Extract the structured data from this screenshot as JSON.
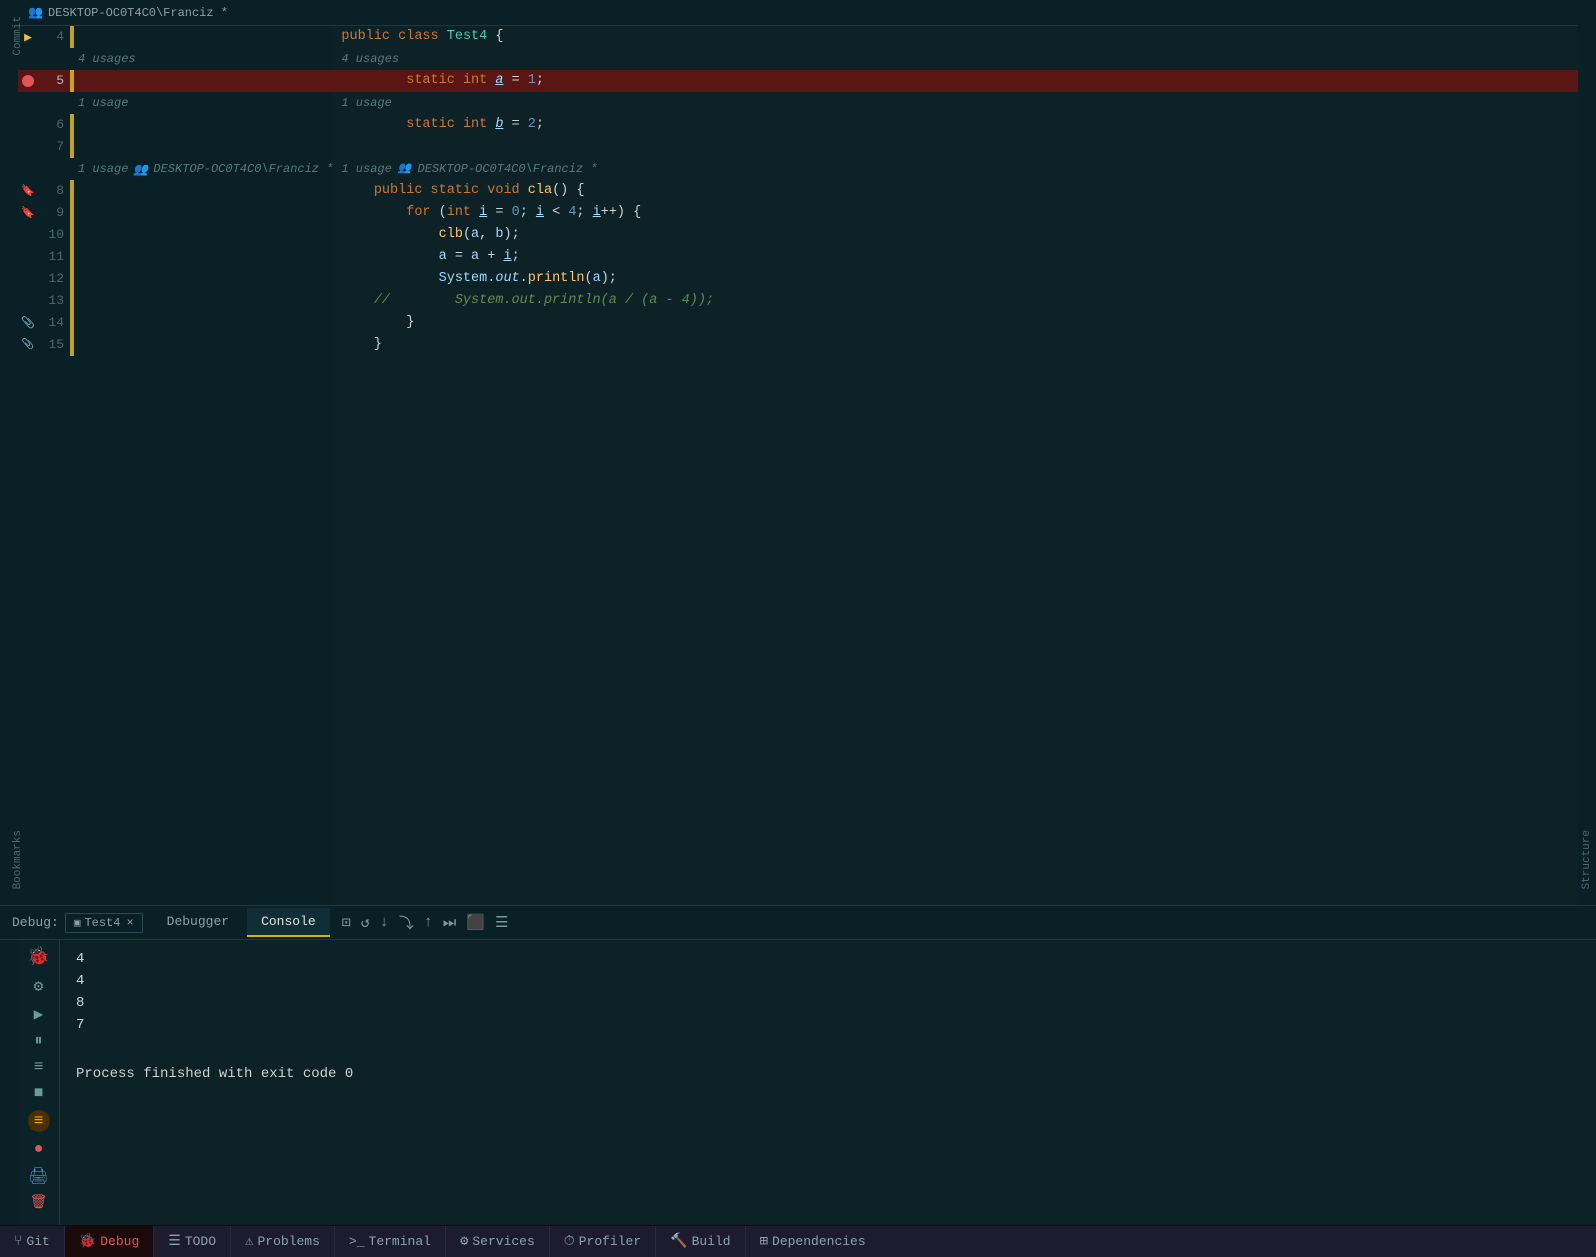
{
  "editor": {
    "git_info": "DESKTOP-OC0T4C0\\Franciz *",
    "lines": [
      {
        "num": 4,
        "content_html": "<span class='kw-public'>public</span> <span class='kw-class'>class</span> <span class='type-name'>Test4</span> <span class='punct'>{</span>",
        "meta": "4 usages",
        "has_arrow": true,
        "has_breakpoint": false,
        "has_bookmark": false,
        "highlighted": false
      },
      {
        "num": 5,
        "content_html": "    <span class='kw-static'>static</span> <span class='kw-int'>int</span> <span class='var-name italic underline'>a</span> = <span class='num'>1</span>;",
        "meta": "1 usage",
        "has_arrow": false,
        "has_breakpoint": true,
        "has_bookmark": false,
        "highlighted": true
      },
      {
        "num": 6,
        "content_html": "    <span class='kw-static'>static</span> <span class='kw-int'>int</span> <span class='var-name italic underline'>b</span> = <span class='num'>2</span>;",
        "meta": null,
        "has_arrow": false,
        "has_breakpoint": false,
        "has_bookmark": false,
        "highlighted": false
      },
      {
        "num": 7,
        "content_html": "",
        "meta": null,
        "has_arrow": false,
        "has_breakpoint": false,
        "has_bookmark": false,
        "highlighted": false
      },
      {
        "num": 8,
        "content_html": "    <span class='kw-public'>public</span> <span class='kw-static'>static</span> <span class='kw-void'>void</span> <span class='method-name'>cla</span>() {",
        "meta_with_user": "1 usage   DESKTOP-OC0T4C0\\Franciz *",
        "has_arrow": false,
        "has_breakpoint": false,
        "has_bookmark": true,
        "bookmark_color": "blue",
        "highlighted": false
      },
      {
        "num": 9,
        "content_html": "        <span class='kw-for'>for</span> (<span class='kw-int'>int</span> <span class='var-name underline'>i</span> = <span class='num'>0</span>; <span class='var-name underline'>i</span> &lt; <span class='num'>4</span>; <span class='var-name underline'>i</span>++) {",
        "meta": null,
        "has_arrow": false,
        "has_breakpoint": false,
        "has_bookmark": true,
        "bookmark_color": "yellow",
        "highlighted": false
      },
      {
        "num": 10,
        "content_html": "            <span class='method-name'>clb</span>(<span class='var-name'>a</span>, <span class='var-name'>b</span>);",
        "meta": null,
        "has_arrow": false,
        "has_breakpoint": false,
        "has_bookmark": false,
        "highlighted": false
      },
      {
        "num": 11,
        "content_html": "            <span class='var-name'>a</span> = <span class='var-name'>a</span> + <span class='var-name underline'>i</span>;",
        "meta": null,
        "has_arrow": false,
        "has_breakpoint": false,
        "has_bookmark": false,
        "highlighted": false
      },
      {
        "num": 12,
        "content_html": "            <span class='sys-out'>System</span>.<span class='kw-out'>out</span>.<span class='method-name'>println</span>(<span class='var-name'>a</span>);",
        "meta": null,
        "has_arrow": false,
        "has_breakpoint": false,
        "has_bookmark": false,
        "highlighted": false
      },
      {
        "num": 13,
        "content_html": "    <span class='comment'>// &nbsp;&nbsp;&nbsp;&nbsp;&nbsp;&nbsp;&nbsp;System.out.println(a / (a - 4));</span>",
        "meta": null,
        "has_arrow": false,
        "has_breakpoint": false,
        "has_bookmark": false,
        "highlighted": false
      },
      {
        "num": 14,
        "content_html": "        }",
        "meta": null,
        "has_arrow": false,
        "has_breakpoint": false,
        "has_bookmark": true,
        "bookmark_color": "green",
        "highlighted": false
      },
      {
        "num": 15,
        "content_html": "    }",
        "meta": null,
        "has_arrow": false,
        "has_breakpoint": false,
        "has_bookmark": true,
        "bookmark_color": "green2",
        "highlighted": false
      }
    ]
  },
  "debug": {
    "title": "Debug:",
    "tab_file": "Test4",
    "close_label": "×",
    "tab_debugger": "Debugger",
    "tab_console": "Console",
    "console_output": [
      "4",
      "4",
      "8",
      "7"
    ],
    "process_text": "Process finished with exit code 0"
  },
  "statusbar": {
    "items": [
      {
        "icon": "⑂",
        "label": "Git"
      },
      {
        "icon": "🐞",
        "label": "Debug"
      },
      {
        "icon": "☰",
        "label": "TODO"
      },
      {
        "icon": "⚠",
        "label": "Problems"
      },
      {
        "icon": ">_",
        "label": "Terminal"
      },
      {
        "icon": "⚙",
        "label": "Services"
      },
      {
        "icon": "⏱",
        "label": "Profiler"
      },
      {
        "icon": "🔨",
        "label": "Build"
      },
      {
        "icon": "⊞",
        "label": "Dependencies"
      }
    ]
  },
  "sidebar_left": {
    "commit_label": "Commit",
    "bookmarks_label": "Bookmarks"
  },
  "sidebar_right": {
    "structure_label": "Structure"
  }
}
